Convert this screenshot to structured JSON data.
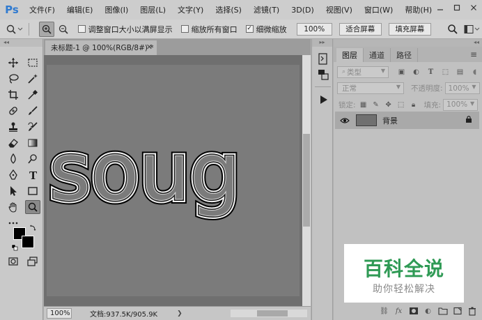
{
  "app": {
    "logo": "Ps",
    "menu": [
      "文件(F)",
      "编辑(E)",
      "图像(I)",
      "图层(L)",
      "文字(Y)",
      "选择(S)",
      "滤镜(T)",
      "3D(D)",
      "视图(V)",
      "窗口(W)",
      "帮助(H)"
    ],
    "window_controls": [
      "minimize-icon",
      "restore-icon",
      "close-icon"
    ]
  },
  "options_bar": {
    "resize_windows_label": "调整窗口大小以满屏显示",
    "resize_windows_checked": false,
    "zoom_all_label": "缩放所有窗口",
    "zoom_all_checked": false,
    "scrubby_zoom_label": "细微缩放",
    "scrubby_zoom_checked": true,
    "zoom_value": "100%",
    "fit_screen_label": "适合屏幕",
    "fill_screen_label": "填充屏幕"
  },
  "document": {
    "tab_title": "未标题-1 @ 100%(RGB/8#) *",
    "canvas_text": "soug",
    "zoom": "100%",
    "doc_info": "文档:937.5K/905.9K"
  },
  "layers_panel": {
    "tabs": [
      "图层",
      "通道",
      "路径"
    ],
    "active_tab": 0,
    "filter_kind": "类型",
    "blend_mode": "正常",
    "opacity_label": "不透明度:",
    "opacity_value": "100%",
    "lock_label": "锁定:",
    "fill_label": "填充:",
    "fill_value": "100%",
    "layers": [
      {
        "name": "背景",
        "visible": true,
        "locked": true
      }
    ]
  },
  "watermark": {
    "title": "百科全说",
    "subtitle": "助你轻松解决",
    "color": "#2f9a55"
  }
}
